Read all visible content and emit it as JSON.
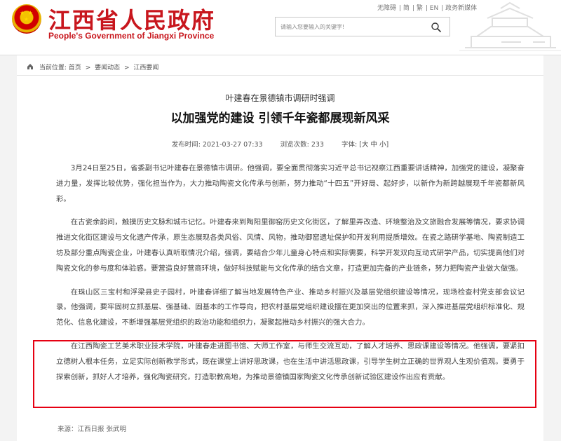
{
  "header": {
    "title": "江西省人民政府",
    "subtitle": "People's Government of Jiangxi Province",
    "top_links": [
      "无障碍",
      "简",
      "繁",
      "EN",
      "政务新媒体"
    ],
    "search": {
      "placeholder": "请输入您要输入的关键字!"
    },
    "colors": {
      "brand": "#c8161d",
      "highlight": "#e60012"
    }
  },
  "breadcrumb": {
    "label": "当前位置:",
    "items": [
      "首页",
      "要闻动态",
      "江西要闻"
    ],
    "separator": ">"
  },
  "article": {
    "kicker": "叶建春在景德镇市调研时强调",
    "title": "以加强党的建设 引领千年瓷都展现新风采",
    "meta": {
      "publish_label": "发布时间:",
      "publish_time": "2021-03-27 07:33",
      "views_label": "浏览次数:",
      "views": "233",
      "font_label": "字体:",
      "font_sizes": [
        "大",
        "中",
        "小"
      ]
    },
    "paragraphs": [
      "3月24日至25日，省委副书记叶建春在景德镇市调研。他强调，要全面贯彻落实习近平总书记视察江西重要讲话精神，加强党的建设，凝聚奋进力量，发挥比较优势，强化担当作为，大力推动陶瓷文化传承与创新，努力推动“十四五”开好局、起好步，以新作为新跨越展现千年瓷都新风彩。",
      "在古瓷余韵间，触摸历史文脉和城市记忆。叶建春来到陶阳里御窑历史文化街区，了解里弄改造、环境整治及文旅融合发展等情况，要求协调推进文化街区建设与文化遗产传承，原生态展现各类风俗、风情、风物，推动御窑遗址保护和开发利用提质增效。在瓷之路研学基地、陶瓷制造工坊及部分重点陶瓷企业，叶建春认真听取情况介绍，强调，要结合少年儿童身心特点和实际需要，科学开发双向互动式研学产品，切实提高他们对陶瓷文化的参与度和体验感。要营造良好营商环境，做好科技赋能与文化传承的结合文章，打造更加完备的产业链条，努力把陶瓷产业做大做强。",
      "在珠山区三宝村和浮梁县史子园村，叶建春详细了解当地发展特色产业、推动乡村振兴及基层党组织建设等情况，现场检查村党支部会议记录。他强调，要牢固树立抓基层、强基础、固基本的工作导向，把农村基层党组织建设摆在更加突出的位置来抓，深入推进基层党组织标准化、规范化、信息化建设，不断增强基层党组织的政治功能和组织力，凝聚起推动乡村振兴的强大合力。",
      "在江西陶瓷工艺美术职业技术学院，叶建春走进图书馆、大师工作室，与师生交流互动，了解人才培养、思政课建设等情况。他强调，要紧扣立德树人根本任务，立足实际创新教学形式，既在课堂上讲好思政课，也在生活中讲活思政课，引导学生树立正确的世界观人生观价值观。要勇于探索创新，抓好人才培养，强化陶瓷研究，打造职教高地，为推动景德镇国家陶瓷文化传承创新试验区建设作出应有贡献。"
    ],
    "source": "来源：江西日报 张武明"
  }
}
